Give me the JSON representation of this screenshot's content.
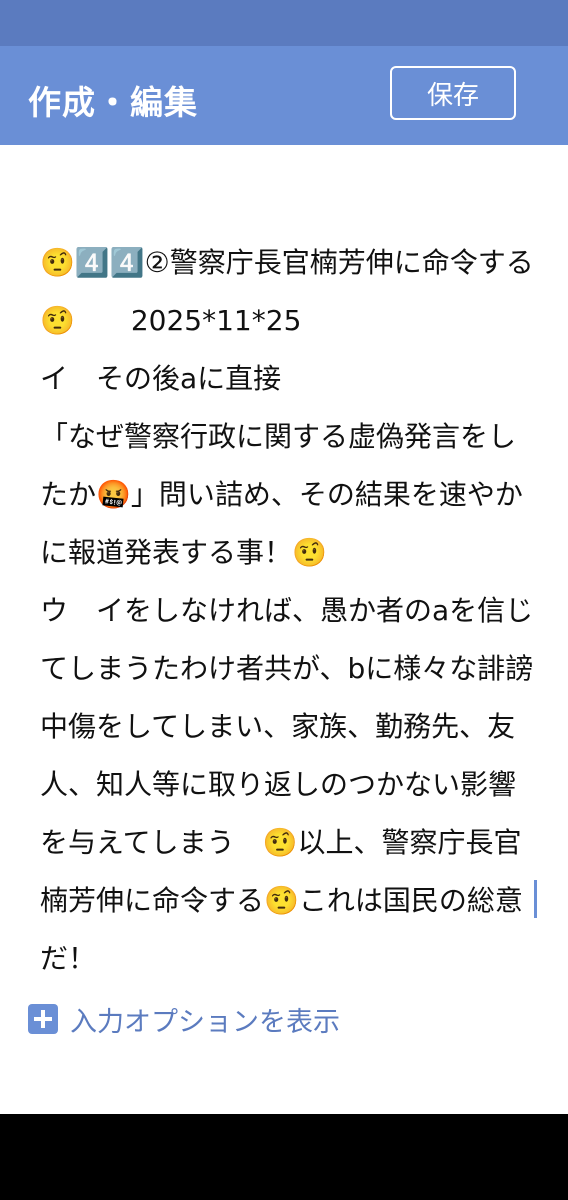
{
  "header": {
    "title": "作成・編集",
    "save_label": "保存"
  },
  "editor": {
    "text": "🤨4️⃣4️⃣②警察庁長官楠芳伸に命令する🤨　　2025*11*25\nイ　その後aに直接\n「なぜ警察行政に関する虚偽発言をしたか🤬」問い詰め、その結果を速やかに報道発表する事！🤨\nウ　イをしなければ、愚か者のaを信じてしまうたわけ者共が、bに様々な誹謗中傷をしてしまい、家族、勤務先、友人、知人等に取り返しのつかない影響を与えてしまう　🤨以上、警察庁長官楠芳伸に命令する🤨これは国民の総意だ！"
  },
  "input_options": {
    "label": "入力オプションを表示",
    "icon": "plus-square-icon"
  },
  "colors": {
    "status_bar": "#5b7bbf",
    "header": "#6a8fd6",
    "accent_text": "#5b7bbf",
    "nav_bar": "#000000"
  }
}
